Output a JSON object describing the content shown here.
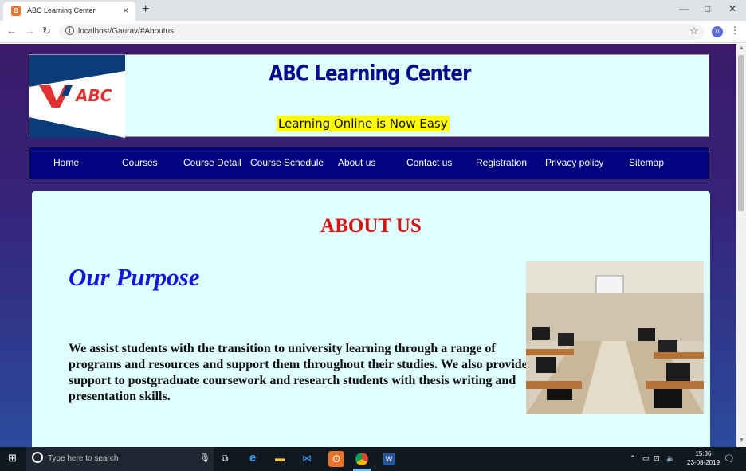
{
  "browser": {
    "tab_title": "ABC Learning Center",
    "tab_close": "×",
    "new_tab": "+",
    "url": "localhost/Gaurav/#Aboutus",
    "profile_initial": "0",
    "win_min": "—",
    "win_max": "□",
    "win_close": "✕"
  },
  "site": {
    "title": "ABC Learning Center",
    "tagline": "Learning Online is Now Easy",
    "logo_text": "ABC"
  },
  "menu": [
    {
      "label": "Home"
    },
    {
      "label": "Courses"
    },
    {
      "label": "Course Detail"
    },
    {
      "label": "Course Schedule"
    },
    {
      "label": "About us"
    },
    {
      "label": "Contact us"
    },
    {
      "label": "Registration"
    },
    {
      "label": "Privacy policy"
    },
    {
      "label": "Sitemap"
    }
  ],
  "page": {
    "heading": "ABOUT US",
    "subheading": "Our Purpose",
    "paragraph": "We assist students with the transition to university learning through a range of programs and resources and support them throughout their studies. We also provide support to postgraduate coursework and research students with thesis writing and presentation skills."
  },
  "taskbar": {
    "search_placeholder": "Type here to search",
    "time": "15:36",
    "date": "23-08-2019"
  },
  "colors": {
    "menu_bg": "#02037e",
    "title": "#0a0a8c",
    "heading": "#e01010",
    "subheading": "#1515d8",
    "tagline_bg": "#ffff00",
    "panel_bg": "#dfffff"
  }
}
